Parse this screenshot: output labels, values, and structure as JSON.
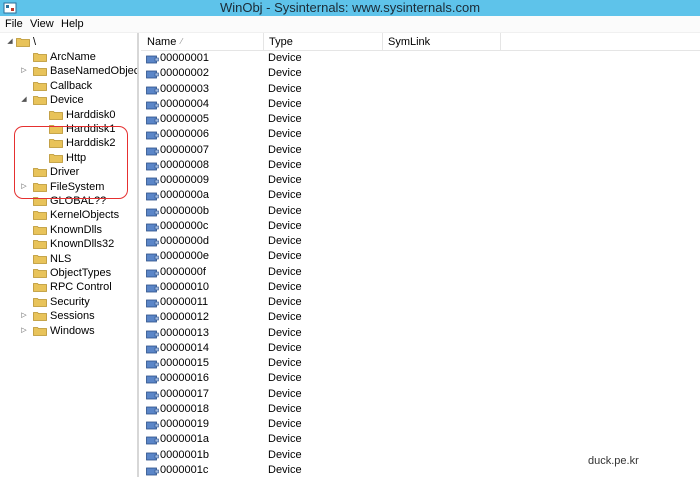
{
  "window": {
    "title": "WinObj - Sysinternals: www.sysinternals.com"
  },
  "menu": [
    {
      "label": "File"
    },
    {
      "label": "View"
    },
    {
      "label": "Help"
    }
  ],
  "tree": {
    "root": "\\",
    "items": [
      {
        "label": "ArcName",
        "expander": ""
      },
      {
        "label": "BaseNamedObjects",
        "expander": "▷"
      },
      {
        "label": "Callback",
        "expander": ""
      },
      {
        "label": "Device",
        "expander": "◢"
      },
      {
        "label": "Harddisk0",
        "expander": ""
      },
      {
        "label": "Harddisk1",
        "expander": ""
      },
      {
        "label": "Harddisk2",
        "expander": ""
      },
      {
        "label": "Http",
        "expander": ""
      },
      {
        "label": "Driver",
        "expander": ""
      },
      {
        "label": "FileSystem",
        "expander": "▷"
      },
      {
        "label": "GLOBAL??",
        "expander": ""
      },
      {
        "label": "KernelObjects",
        "expander": ""
      },
      {
        "label": "KnownDlls",
        "expander": ""
      },
      {
        "label": "KnownDlls32",
        "expander": ""
      },
      {
        "label": "NLS",
        "expander": ""
      },
      {
        "label": "ObjectTypes",
        "expander": ""
      },
      {
        "label": "RPC Control",
        "expander": ""
      },
      {
        "label": "Security",
        "expander": ""
      },
      {
        "label": "Sessions",
        "expander": "▷"
      },
      {
        "label": "Windows",
        "expander": "▷"
      }
    ]
  },
  "list": {
    "columns": {
      "name": "Name",
      "type": "Type",
      "symlink": "SymLink",
      "sort": "⁄"
    },
    "rows": [
      {
        "name": "00000001",
        "type": "Device",
        "symlink": ""
      },
      {
        "name": "00000002",
        "type": "Device",
        "symlink": ""
      },
      {
        "name": "00000003",
        "type": "Device",
        "symlink": ""
      },
      {
        "name": "00000004",
        "type": "Device",
        "symlink": ""
      },
      {
        "name": "00000005",
        "type": "Device",
        "symlink": ""
      },
      {
        "name": "00000006",
        "type": "Device",
        "symlink": ""
      },
      {
        "name": "00000007",
        "type": "Device",
        "symlink": ""
      },
      {
        "name": "00000008",
        "type": "Device",
        "symlink": ""
      },
      {
        "name": "00000009",
        "type": "Device",
        "symlink": ""
      },
      {
        "name": "0000000a",
        "type": "Device",
        "symlink": ""
      },
      {
        "name": "0000000b",
        "type": "Device",
        "symlink": ""
      },
      {
        "name": "0000000c",
        "type": "Device",
        "symlink": ""
      },
      {
        "name": "0000000d",
        "type": "Device",
        "symlink": ""
      },
      {
        "name": "0000000e",
        "type": "Device",
        "symlink": ""
      },
      {
        "name": "0000000f",
        "type": "Device",
        "symlink": ""
      },
      {
        "name": "00000010",
        "type": "Device",
        "symlink": ""
      },
      {
        "name": "00000011",
        "type": "Device",
        "symlink": ""
      },
      {
        "name": "00000012",
        "type": "Device",
        "symlink": ""
      },
      {
        "name": "00000013",
        "type": "Device",
        "symlink": ""
      },
      {
        "name": "00000014",
        "type": "Device",
        "symlink": ""
      },
      {
        "name": "00000015",
        "type": "Device",
        "symlink": ""
      },
      {
        "name": "00000016",
        "type": "Device",
        "symlink": ""
      },
      {
        "name": "00000017",
        "type": "Device",
        "symlink": ""
      },
      {
        "name": "00000018",
        "type": "Device",
        "symlink": ""
      },
      {
        "name": "00000019",
        "type": "Device",
        "symlink": ""
      },
      {
        "name": "0000001a",
        "type": "Device",
        "symlink": ""
      },
      {
        "name": "0000001b",
        "type": "Device",
        "symlink": ""
      },
      {
        "name": "0000001c",
        "type": "Device",
        "symlink": ""
      }
    ]
  },
  "watermark": "duck.pe.kr",
  "colors": {
    "titlebar": "#5ec3ea",
    "folder": "#e8c35a",
    "highlight": "#e53030"
  }
}
